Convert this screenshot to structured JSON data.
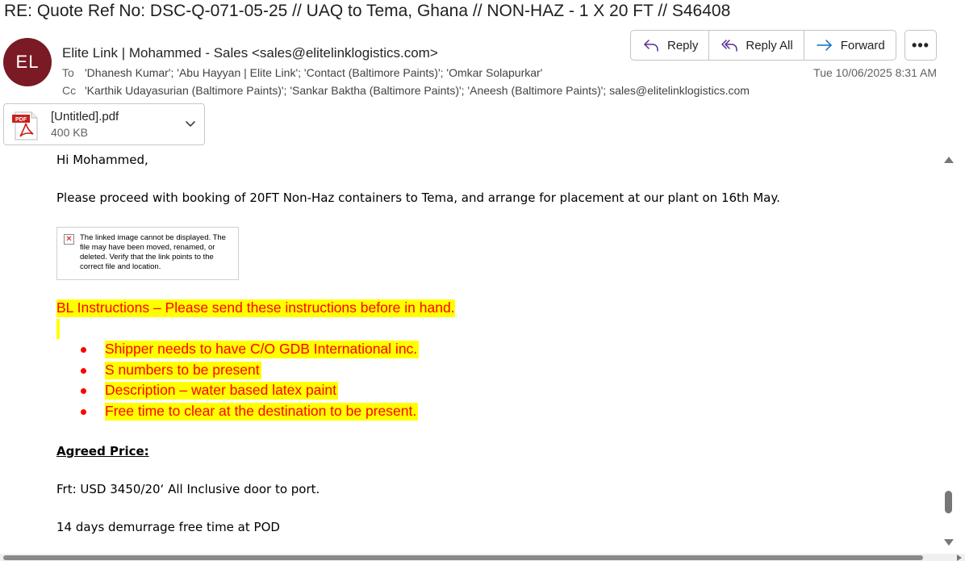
{
  "email": {
    "subject": "RE: Quote Ref No: DSC-Q-071-05-25 // UAQ to Tema, Ghana // NON-HAZ - 1 X 20 FT // S46408",
    "avatar_initials": "EL",
    "avatar_color": "#7a1a24",
    "from": "Elite Link | Mohammed - Sales <sales@elitelinklogistics.com>",
    "to_label": "To",
    "to": "'Dhanesh Kumar'; 'Abu Hayyan | Elite Link'; 'Contact (Baltimore Paints)'; 'Omkar Solapurkar'",
    "cc_label": "Cc",
    "cc": "'Karthik Udayasurian (Baltimore Paints)'; 'Sankar Baktha (Baltimore Paints)'; 'Aneesh (Baltimore Paints)'; sales@elitelinklogistics.com",
    "date": "Tue 10/06/2025 8:31 AM"
  },
  "actions": {
    "reply": "Reply",
    "reply_all": "Reply All",
    "forward": "Forward",
    "more": "•••"
  },
  "attachment": {
    "icon_label": "PDF",
    "name": "[Untitled].pdf",
    "size": "400 KB"
  },
  "body": {
    "greeting": "Hi Mohammed,",
    "para1": "Please proceed with booking of 20FT Non-Haz containers to Tema, and arrange for placement at our plant on 16th May.",
    "broken_image_text": "The linked image cannot be displayed. The file may have been moved, renamed, or deleted. Verify that the link points to the correct file and location.",
    "bl_title": "BL Instructions – Please send these instructions before in hand.",
    "bl_items": [
      "Shipper needs to have C/O GDB International inc.",
      "S numbers to be present",
      "Description – water based latex paint",
      "Free time to clear at the destination to be present."
    ],
    "agreed_heading": "Agreed Price:",
    "freight": "Frt: USD 3450/20‘ All Inclusive door to port.",
    "demurrage": "14 days demurrage free time at POD"
  },
  "colors": {
    "highlight": "#ffff00",
    "instruction_text": "#ff0000",
    "accent": "#0f6cbd"
  }
}
